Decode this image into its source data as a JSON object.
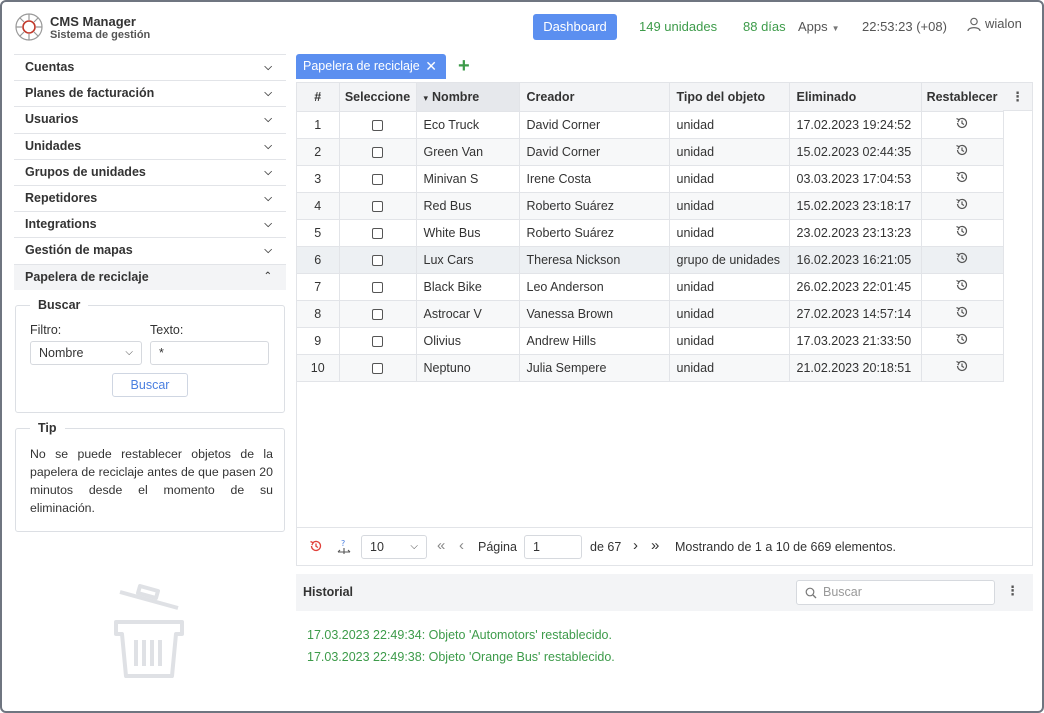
{
  "header": {
    "title": "CMS Manager",
    "subtitle": "Sistema de gestión",
    "dashboard_label": "Dashboard",
    "units_count": "149 unidades",
    "days_left": "88 días",
    "apps_label": "Apps",
    "clock": "22:53:23 (+08)",
    "user": "wialon",
    "accent_color": "#5b8ff0",
    "green_color": "#3d9b4a"
  },
  "sidebar": {
    "items": [
      {
        "label": "Cuentas",
        "icon": "chevron-down-icon"
      },
      {
        "label": "Planes de facturación",
        "icon": "chevron-down-icon"
      },
      {
        "label": "Usuarios",
        "icon": "chevron-down-icon"
      },
      {
        "label": "Unidades",
        "icon": "chevron-down-icon"
      },
      {
        "label": "Grupos de unidades",
        "icon": "chevron-down-icon"
      },
      {
        "label": "Repetidores",
        "icon": "chevron-down-icon"
      },
      {
        "label": "Integrations",
        "icon": "chevron-down-icon"
      },
      {
        "label": "Gestión de mapas",
        "icon": "chevron-down-icon"
      },
      {
        "label": "Papelera de reciclaje",
        "icon": "chevron-up-icon",
        "active": true
      }
    ],
    "search": {
      "legend": "Buscar",
      "filter_label": "Filtro:",
      "filter_value": "Nombre",
      "text_label": "Texto:",
      "text_value": "*",
      "button": "Buscar"
    },
    "tip": {
      "legend": "Tip",
      "text": "No se puede restablecer objetos de la papelera de reciclaje antes de que pasen 20 minutos desde el momento de su eliminación."
    }
  },
  "tabs": [
    {
      "label": "Papelera de reciclaje",
      "close": "✕"
    }
  ],
  "add_tab": "+",
  "table": {
    "columns": [
      "#",
      "Seleccione",
      "Nombre",
      "Creador",
      "Tipo del objeto",
      "Eliminado",
      "Restablecer"
    ],
    "sort_indicator": "▾",
    "rows": [
      {
        "n": "1",
        "name": "Eco Truck",
        "creator": "David Corner",
        "type": "unidad",
        "deleted": "17.02.2023 19:24:52"
      },
      {
        "n": "2",
        "name": "Green Van",
        "creator": "David Corner",
        "type": "unidad",
        "deleted": "15.02.2023 02:44:35"
      },
      {
        "n": "3",
        "name": "Minivan S",
        "creator": "Irene Costa",
        "type": "unidad",
        "deleted": "03.03.2023 17:04:53"
      },
      {
        "n": "4",
        "name": "Red Bus",
        "creator": "Roberto Suárez",
        "type": "unidad",
        "deleted": "15.02.2023 23:18:17"
      },
      {
        "n": "5",
        "name": "White Bus",
        "creator": "Roberto Suárez",
        "type": "unidad",
        "deleted": "23.02.2023 23:13:23"
      },
      {
        "n": "6",
        "name": "Lux Cars",
        "creator": "Theresa Nickson",
        "type": "grupo de unidades",
        "deleted": "16.02.2023 16:21:05"
      },
      {
        "n": "7",
        "name": "Black Bike",
        "creator": "Leo Anderson",
        "type": "unidad",
        "deleted": "26.02.2023 22:01:45"
      },
      {
        "n": "8",
        "name": "Astrocar V",
        "creator": "Vanessa Brown",
        "type": "unidad",
        "deleted": "27.02.2023 14:57:14"
      },
      {
        "n": "9",
        "name": "Olivius",
        "creator": "Andrew Hills",
        "type": "unidad",
        "deleted": "17.03.2023 21:33:50"
      },
      {
        "n": "10",
        "name": "Neptuno",
        "creator": "Julia Sempere",
        "type": "unidad",
        "deleted": "21.02.2023 20:18:51"
      }
    ]
  },
  "pager": {
    "page_size": "10",
    "page_label": "Página",
    "page_value": "1",
    "of_label": "de 67",
    "summary": "Mostrando de 1 a 10 de 669 elementos."
  },
  "history": {
    "title": "Historial",
    "search_placeholder": "Buscar",
    "entries": [
      "17.03.2023 22:49:34: Objeto 'Automotors' restablecido.",
      "17.03.2023 22:49:38: Objeto 'Orange Bus' restablecido."
    ]
  }
}
